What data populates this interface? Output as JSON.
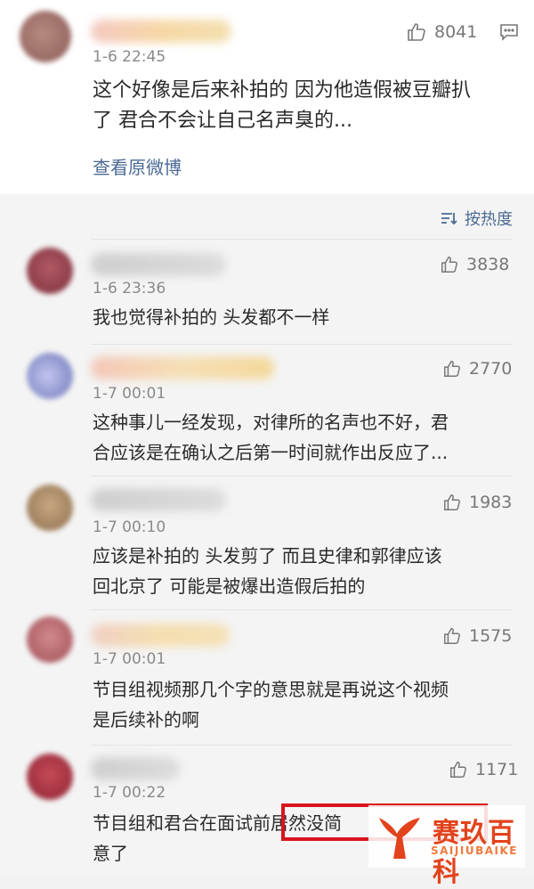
{
  "top_comment": {
    "time": "1-6 22:45",
    "likes": "8041",
    "text_line1": "这个好像是后来补拍的 因为他造假被豆瓣扒",
    "text_line2": "了 君合不会让自己名声臭的...",
    "view_original": "查看原微博"
  },
  "sort_label": "按热度",
  "replies": [
    {
      "time": "1-6 23:36",
      "likes": "3838",
      "line1": "我也觉得补拍的 头发都不一样",
      "line2": ""
    },
    {
      "time": "1-7 00:01",
      "likes": "2770",
      "line1": "这种事儿一经发现，对律所的名声也不好，君",
      "line2": "合应该是在确认之后第一时间就作出反应了..."
    },
    {
      "time": "1-7 00:10",
      "likes": "1983",
      "line1": "应该是补拍的 头发剪了 而且史律和郭律应该",
      "line2": "回北京了 可能是被爆出造假后拍的"
    },
    {
      "time": "1-7 00:01",
      "likes": "1575",
      "line1": "节目组视频那几个字的意思就是再说这个视频",
      "line2": "是后续补的啊"
    },
    {
      "time": "1-7 00:22",
      "likes": "1171",
      "line1": "节目组和君合在面试前居然没简",
      "line2": "意了"
    }
  ],
  "watermark": {
    "title": "赛玖百科",
    "subtitle": "SAIJIUBAIKE"
  },
  "colors": {
    "link": "#4b6a94",
    "highlight": "#d8151c",
    "watermark": "#e2431c"
  },
  "icons": {
    "like": "thumbs-up-icon",
    "comment": "comment-icon",
    "sort": "sort-icon"
  }
}
